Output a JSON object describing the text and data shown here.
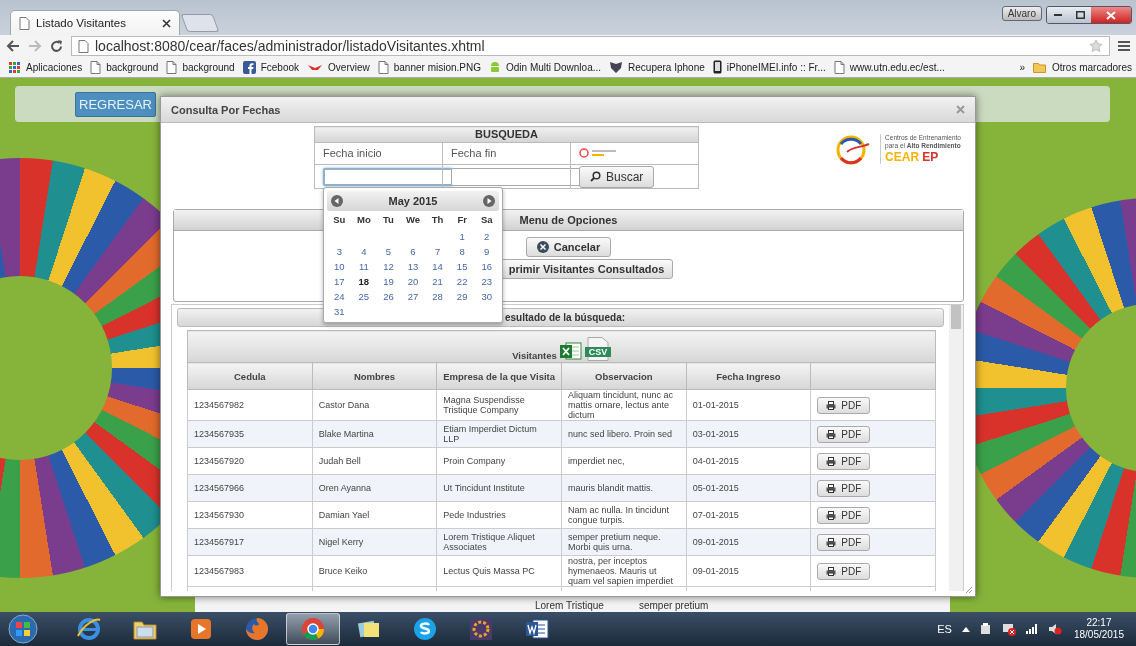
{
  "browser": {
    "tab_title": "Listado Visitantes",
    "user": "Alvaro",
    "url": "localhost:8080/cear/faces/administrador/listadoVisitantes.xhtml",
    "bookmarks": [
      {
        "kind": "grid",
        "label": "Aplicaciones"
      },
      {
        "kind": "document",
        "label": "background"
      },
      {
        "kind": "document",
        "label": "background"
      },
      {
        "kind": "fb",
        "label": "Fcebook"
      },
      {
        "kind": "wing",
        "label": "Overview"
      },
      {
        "kind": "document",
        "label": "banner mision.PNG"
      },
      {
        "kind": "robot",
        "label": "Odin Multi Downloa..."
      },
      {
        "kind": "shield",
        "label": "Recupera Iphone"
      },
      {
        "kind": "phone",
        "label": "iPhoneIMEI.info :: Fr..."
      },
      {
        "kind": "document",
        "label": "www.utn.edu.ec/est..."
      }
    ],
    "more": "»",
    "other": {
      "kind": "folder",
      "label": "Otros marcadores"
    }
  },
  "page": {
    "back_button": "REGRESAR",
    "behind_cells": [
      "Lorem Tristique",
      "semper pretium"
    ]
  },
  "dialog": {
    "title": "Consulta Por Fechas",
    "search": {
      "header": "BUSQUEDA",
      "fields": [
        {
          "label": "Fecha inicio",
          "focused": true
        },
        {
          "label": "Fecha fin",
          "focused": false
        }
      ],
      "button": "Buscar"
    },
    "logo": {
      "line1": "Centros de Entrenamiento",
      "line2": "para el **Alto Rendimiento**",
      "brand1": "CEAR",
      "brand2": "EP"
    },
    "menu": {
      "header": "Menu de Opciones",
      "cancel": "Cancelar",
      "print": "primir Visitantes Consultados"
    },
    "calendar": {
      "month": "May 2015",
      "weekdays": [
        "Su",
        "Mo",
        "Tu",
        "We",
        "Th",
        "Fr",
        "Sa"
      ],
      "weeks": [
        [
          {
            "d": "1",
            "today": false
          },
          {
            "d": "2",
            "today": false
          }
        ],
        [
          {
            "d": "3",
            "today": false
          },
          {
            "d": "4",
            "today": false
          },
          {
            "d": "5",
            "today": false
          },
          {
            "d": "6",
            "today": false
          },
          {
            "d": "7",
            "today": false
          },
          {
            "d": "8",
            "today": false
          },
          {
            "d": "9",
            "today": false
          }
        ],
        [
          {
            "d": "10",
            "today": false
          },
          {
            "d": "11",
            "today": false
          },
          {
            "d": "12",
            "today": false
          },
          {
            "d": "13",
            "today": false
          },
          {
            "d": "14",
            "today": false
          },
          {
            "d": "15",
            "today": false
          },
          {
            "d": "16",
            "today": false
          }
        ],
        [
          {
            "d": "17",
            "today": false
          },
          {
            "d": "18",
            "today": true
          },
          {
            "d": "19",
            "today": false
          },
          {
            "d": "20",
            "today": false
          },
          {
            "d": "21",
            "today": false
          },
          {
            "d": "22",
            "today": false
          },
          {
            "d": "23",
            "today": false
          }
        ],
        [
          {
            "d": "24",
            "today": false
          },
          {
            "d": "25",
            "today": false
          },
          {
            "d": "26",
            "today": false
          },
          {
            "d": "27",
            "today": false
          },
          {
            "d": "28",
            "today": false
          },
          {
            "d": "29",
            "today": false
          },
          {
            "d": "30",
            "today": false
          }
        ],
        [
          {
            "d": "31",
            "today": false
          }
        ]
      ]
    },
    "result": {
      "header": "esultado de la búsqueda:",
      "table_title": "Visitantes",
      "csv_label": "CSV",
      "columns": [
        "Cedula",
        "Nombres",
        "Empresa de la que Visita",
        "Observacion",
        "Fecha Ingreso"
      ],
      "rows": [
        {
          "cells": [
            "1234567982",
            "Castor Dana",
            "Magna Suspendisse Tristique Company",
            "Aliquam tincidunt, nunc ac mattis ornare, lectus ante dictum",
            "01-01-2015"
          ],
          "button": "PDF"
        },
        {
          "cells": [
            "1234567935",
            "Blake Martina",
            "Etiam Imperdiet Dictum LLP",
            "nunc sed libero. Proin sed",
            "03-01-2015"
          ],
          "button": "PDF"
        },
        {
          "cells": [
            "1234567920",
            "Judah Bell",
            "Proin Company",
            "imperdiet nec,",
            "04-01-2015"
          ],
          "button": "PDF"
        },
        {
          "cells": [
            "1234567966",
            "Oren Ayanna",
            "Ut Tincidunt Institute",
            "mauris blandit mattis.",
            "05-01-2015"
          ],
          "button": "PDF"
        },
        {
          "cells": [
            "1234567930",
            "Damian Yael",
            "Pede Industries",
            "Nam ac nulla. In tincidunt congue turpis.",
            "07-01-2015"
          ],
          "button": "PDF"
        },
        {
          "cells": [
            "1234567917",
            "Nigel Kerry",
            "Lorem Tristique Aliquet Associates",
            "semper pretium neque. Morbi quis urna.",
            "09-01-2015"
          ],
          "button": "PDF"
        },
        {
          "cells": [
            "1234567983",
            "Bruce Keiko",
            "Lectus Quis Massa PC",
            "nostra, per inceptos hymenaeos. Mauris ut quam vel sapien imperdiet",
            "09-01-2015"
          ],
          "button": "PDF"
        }
      ]
    }
  },
  "taskbar": {
    "apps": [
      {
        "kind": "ie",
        "selected": false
      },
      {
        "kind": "files",
        "selected": false
      },
      {
        "kind": "media",
        "selected": false
      },
      {
        "kind": "firefox",
        "selected": false
      },
      {
        "kind": "chrome",
        "selected": true
      },
      {
        "kind": "notes",
        "selected": false
      },
      {
        "kind": "skype",
        "selected": false
      },
      {
        "kind": "java",
        "selected": false
      },
      {
        "kind": "word",
        "selected": false
      }
    ],
    "language": "ES",
    "time": "22:17",
    "date": "18/05/2015"
  }
}
